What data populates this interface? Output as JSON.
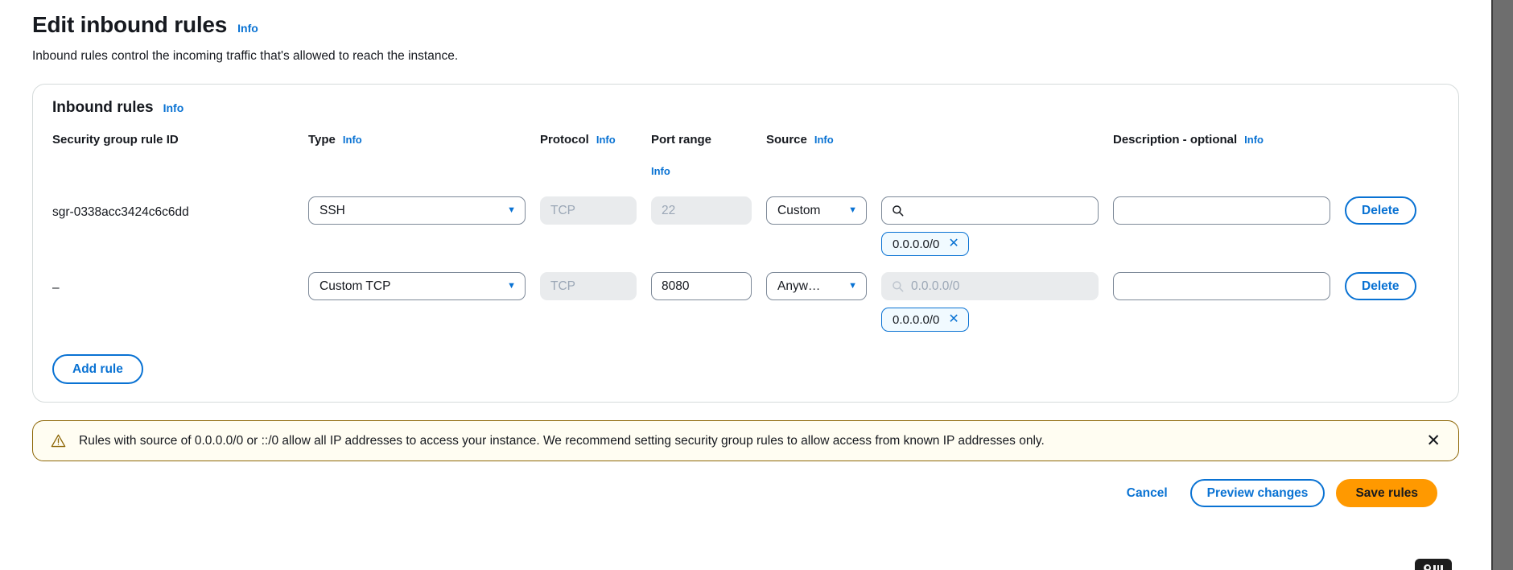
{
  "page": {
    "title": "Edit inbound rules",
    "info_label": "Info",
    "description": "Inbound rules control the incoming traffic that's allowed to reach the instance."
  },
  "card": {
    "title": "Inbound rules",
    "info_label": "Info",
    "add_rule_label": "Add rule",
    "columns": {
      "rule_id": "Security group rule ID",
      "type": "Type",
      "type_info": "Info",
      "protocol": "Protocol",
      "protocol_info": "Info",
      "port_range": "Port range",
      "port_range_info": "Info",
      "source": "Source",
      "source_info": "Info",
      "description": "Description - optional",
      "description_info": "Info"
    },
    "rules": [
      {
        "rule_id": "sgr-0338acc3424c6c6dd",
        "type": "SSH",
        "protocol": "TCP",
        "port_range": "22",
        "source_kind": "Custom",
        "source_value": "",
        "source_placeholder": "",
        "source_disabled": false,
        "port_disabled": true,
        "token": "0.0.0.0/0",
        "token_remove": "✕",
        "description": "",
        "delete_label": "Delete"
      },
      {
        "rule_id": "–",
        "type": "Custom TCP",
        "protocol": "TCP",
        "port_range": "8080",
        "source_kind": "Anyw…",
        "source_value": "",
        "source_placeholder": "0.0.0.0/0",
        "source_disabled": true,
        "port_disabled": false,
        "token": "0.0.0.0/0",
        "token_remove": "✕",
        "description": "",
        "delete_label": "Delete"
      }
    ]
  },
  "alert": {
    "icon": "warning-triangle-icon",
    "message": "Rules with source of 0.0.0.0/0 or ::/0 allow all IP addresses to access your instance. We recommend setting security group rules to allow access from known IP addresses only.",
    "close_label": "✕"
  },
  "footer": {
    "cancel_label": "Cancel",
    "preview_label": "Preview changes",
    "save_label": "Save rules"
  },
  "colors": {
    "link_blue": "#0972d3",
    "primary_orange": "#ff9900",
    "warning_border": "#8d6605",
    "warning_bg": "#fffdf2",
    "token_bg": "#f1faff",
    "disabled_bg": "#e9ebed"
  }
}
